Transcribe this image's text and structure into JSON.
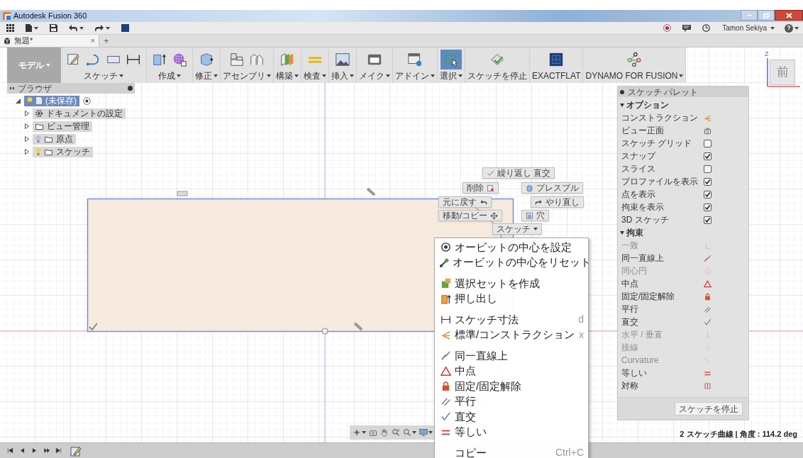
{
  "window": {
    "title": "Autodesk Fusion 360"
  },
  "account": {
    "user": "Tamon Sekiya",
    "help": "?"
  },
  "document_tabs": {
    "tabs": [
      {
        "label": "無題*",
        "close": "×",
        "selected": true
      }
    ],
    "new_tab": "+"
  },
  "ribbon": {
    "workspace": "モデル",
    "groups": [
      {
        "label": "スケッチ",
        "dropdown": true,
        "selected": false
      },
      {
        "label": "作成",
        "dropdown": true,
        "selected": false
      },
      {
        "label": "修正",
        "dropdown": true,
        "selected": false
      },
      {
        "label": "アセンブリ",
        "dropdown": true,
        "selected": false
      },
      {
        "label": "構築",
        "dropdown": true,
        "selected": false
      },
      {
        "label": "検査",
        "dropdown": true,
        "selected": false
      },
      {
        "label": "挿入",
        "dropdown": true,
        "selected": false
      },
      {
        "label": "メイク",
        "dropdown": true,
        "selected": false
      },
      {
        "label": "アドイン",
        "dropdown": true,
        "selected": false
      },
      {
        "label": "選択",
        "dropdown": true,
        "selected": true
      },
      {
        "label": "スケッチを停止",
        "dropdown": false,
        "selected": false
      },
      {
        "label": "EXACTFLAT",
        "dropdown": false,
        "selected": false
      },
      {
        "label": "DYNAMO FOR FUSION",
        "dropdown": true,
        "selected": false
      }
    ]
  },
  "browser": {
    "title": "ブラウザ",
    "tree": [
      {
        "label": "(未保存)",
        "kind": "document",
        "expanded": true,
        "visible": true,
        "children": [
          {
            "label": "ドキュメントの設定",
            "kind": "settings",
            "expanded": false
          },
          {
            "label": "ビュー管理",
            "kind": "folder",
            "expanded": false
          },
          {
            "label": "原点",
            "kind": "folder",
            "expanded": false,
            "visible": false
          },
          {
            "label": "スケッチ",
            "kind": "folder",
            "expanded": false,
            "visible": true
          }
        ]
      }
    ]
  },
  "view_cube": {
    "face": "前",
    "axis": "Z"
  },
  "marking_menu": [
    {
      "label": "繰り返し 直交",
      "kind": "repeat"
    },
    {
      "label": "削除",
      "kind": "delete"
    },
    {
      "label": "プレスプル",
      "kind": "presspull"
    },
    {
      "label": "元に戻す",
      "kind": "undo"
    },
    {
      "label": "やり直し",
      "kind": "redo"
    },
    {
      "label": "移動/コピー",
      "kind": "move"
    },
    {
      "label": "穴",
      "kind": "hole"
    },
    {
      "label": "スケッチ",
      "kind": "dropdown"
    }
  ],
  "context_menu": [
    [
      {
        "label": "オービットの中心を設定",
        "kind": "orbit_set"
      },
      {
        "label": "オービットの中心をリセット",
        "kind": "orbit_reset"
      }
    ],
    [
      {
        "label": "選択セットを作成",
        "kind": "selection_set"
      },
      {
        "label": "押し出し",
        "kind": "extrude"
      }
    ],
    [
      {
        "label": "スケッチ寸法",
        "kind": "dimension",
        "shortcut": "d"
      },
      {
        "label": "標準/コンストラクション",
        "kind": "construction",
        "shortcut": "x"
      }
    ],
    [
      {
        "label": "同一直線上",
        "kind": "collinear"
      },
      {
        "label": "中点",
        "kind": "midpoint"
      },
      {
        "label": "固定/固定解除",
        "kind": "fix"
      },
      {
        "label": "平行",
        "kind": "parallel"
      },
      {
        "label": "直交",
        "kind": "perpendicular"
      },
      {
        "label": "等しい",
        "kind": "equal"
      }
    ],
    [
      {
        "label": "コピー",
        "kind": "none",
        "shortcut": "Ctrl+C"
      }
    ]
  ],
  "sketch_palette": {
    "title": "スケッチ パレット",
    "sections": [
      {
        "title": "オプション",
        "expanded": true,
        "rows": [
          {
            "label": "コンストラクション",
            "kind": "construction"
          },
          {
            "label": "ビュー正面",
            "kind": "look_at"
          },
          {
            "label": "スケッチ グリッド",
            "kind": "checkbox",
            "checked": false
          },
          {
            "label": "スナップ",
            "kind": "checkbox",
            "checked": true
          },
          {
            "label": "スライス",
            "kind": "checkbox",
            "checked": false
          },
          {
            "label": "プロファイルを表示",
            "kind": "checkbox",
            "checked": true
          },
          {
            "label": "点を表示",
            "kind": "checkbox",
            "checked": true
          },
          {
            "label": "拘束を表示",
            "kind": "checkbox",
            "checked": true
          },
          {
            "label": "3D スケッチ",
            "kind": "checkbox",
            "checked": true
          }
        ]
      },
      {
        "title": "拘束",
        "expanded": true,
        "rows": [
          {
            "label": "一致",
            "kind": "coincident",
            "disabled": true
          },
          {
            "label": "同一直線上",
            "kind": "collinear",
            "disabled": false
          },
          {
            "label": "同心円",
            "kind": "concentric",
            "disabled": true
          },
          {
            "label": "中点",
            "kind": "midpoint",
            "disabled": false
          },
          {
            "label": "固定/固定解除",
            "kind": "fix",
            "disabled": false
          },
          {
            "label": "平行",
            "kind": "parallel",
            "disabled": false
          },
          {
            "label": "直交",
            "kind": "perpendicular",
            "disabled": false
          },
          {
            "label": "水平 / 垂直",
            "kind": "horizontal_vertical",
            "disabled": true
          },
          {
            "label": "接線",
            "kind": "tangent",
            "disabled": true
          },
          {
            "label": "Curvature",
            "kind": "curvature",
            "disabled": true
          },
          {
            "label": "等しい",
            "kind": "equal",
            "disabled": false
          },
          {
            "label": "対称",
            "kind": "symmetry",
            "disabled": false
          }
        ]
      }
    ],
    "button": "スケッチを停止"
  },
  "status_bar": {
    "selection": "2 スケッチ曲線 | 角度 : 114.2 deg"
  }
}
